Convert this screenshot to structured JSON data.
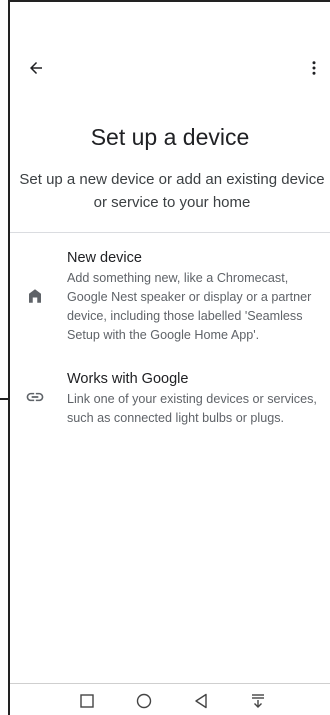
{
  "appbar": {
    "back_icon": "arrow-back-icon",
    "more_icon": "more-vert-icon"
  },
  "header": {
    "title": "Set up a device",
    "subtitle": "Set up a new device or add an existing device or service to your home"
  },
  "options": [
    {
      "icon": "home-icon",
      "title": "New device",
      "description": "Add something new, like a Chromecast, Google Nest speaker or display or a partner device, including those labelled 'Seamless Setup with the Google Home App'."
    },
    {
      "icon": "link-icon",
      "title": "Works with Google",
      "description": "Link one of your existing devices or services, such as connected light bulbs or plugs."
    }
  ],
  "navbar": {
    "icons": [
      "square-recent-icon",
      "circle-home-icon",
      "triangle-back-icon",
      "arrow-down-icon"
    ]
  },
  "colors": {
    "text_primary": "#202124",
    "text_secondary": "#5f6368",
    "divider": "#dadce0",
    "icon": "#5f6368"
  }
}
